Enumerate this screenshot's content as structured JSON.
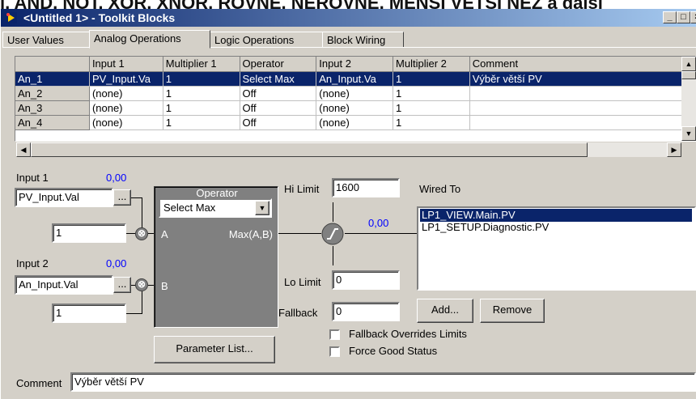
{
  "background_text": "í, AND, NOT, XOR, XNOR, ROVNÉ, NEROVNÉ, MENŠÍ VĚTŠÍ NEŽ a další",
  "window": {
    "title": "<Untitled 1> - Toolkit Blocks",
    "controls": {
      "minimize": "_",
      "maximize": "□",
      "close": "×"
    }
  },
  "tabs": [
    "User Values",
    "Analog Operations",
    "Logic Operations",
    "Block Wiring"
  ],
  "active_tab": "Analog Operations",
  "grid": {
    "columns": [
      "Input 1",
      "Multiplier 1",
      "Operator",
      "Input 2",
      "Multiplier 2",
      "Comment"
    ],
    "rows": [
      {
        "id": "An_1",
        "cells": [
          "PV_Input.Va",
          "1",
          "Select Max",
          "An_Input.Va",
          "1",
          "Výběr větší PV"
        ],
        "selected": true
      },
      {
        "id": "An_2",
        "cells": [
          "(none)",
          "1",
          "Off",
          "(none)",
          "1",
          ""
        ]
      },
      {
        "id": "An_3",
        "cells": [
          "(none)",
          "1",
          "Off",
          "(none)",
          "1",
          ""
        ]
      },
      {
        "id": "An_4",
        "cells": [
          "(none)",
          "1",
          "Off",
          "(none)",
          "1",
          ""
        ]
      }
    ]
  },
  "input1": {
    "label": "Input 1",
    "value": "0,00",
    "source": "PV_Input.Val",
    "browse": "...",
    "multiplier": "1"
  },
  "input2": {
    "label": "Input 2",
    "value": "0,00",
    "source": "An_Input.Val",
    "browse": "...",
    "multiplier": "1"
  },
  "operator": {
    "label": "Operator",
    "selected": "Select Max",
    "function": "Max(A,B)",
    "port_a": "A",
    "port_b": "B",
    "mult_symbol": "⊗"
  },
  "limits": {
    "hi_label": "Hi Limit",
    "hi_value": "1600",
    "lo_label": "Lo Limit",
    "lo_value": "0",
    "fallback_label": "Fallback",
    "fallback_value": "0",
    "output_value": "0,00"
  },
  "wired_to": {
    "label": "Wired To",
    "items": [
      "LP1_VIEW.Main.PV",
      "LP1_SETUP.Diagnostic.PV"
    ],
    "add": "Add...",
    "remove": "Remove"
  },
  "checkboxes": [
    {
      "label": "Fallback Overrides Limits",
      "checked": false
    },
    {
      "label": "Force Good Status",
      "checked": false
    }
  ],
  "parameter_list": "Parameter List...",
  "comment": {
    "label": "Comment",
    "value": "Výběr větší PV"
  },
  "colors": {
    "selection": "#0a246a",
    "face": "#d4d0c8",
    "value_blue": "#0000ff",
    "operator_bg": "#808080"
  }
}
